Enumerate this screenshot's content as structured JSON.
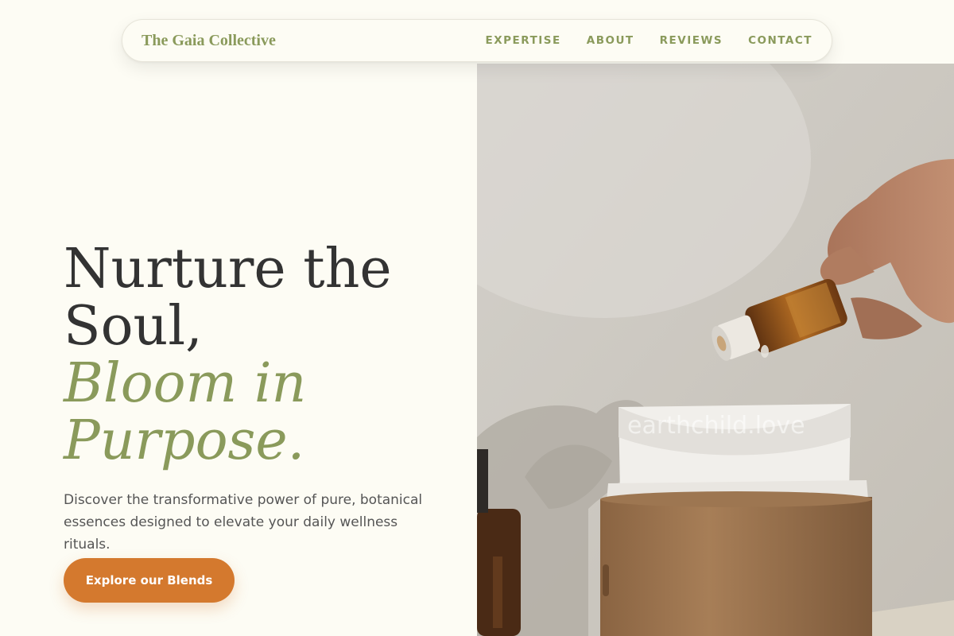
{
  "nav": {
    "brand": "The Gaia Collective",
    "links": [
      "EXPERTISE",
      "ABOUT",
      "REVIEWS",
      "CONTACT"
    ]
  },
  "hero": {
    "title_line1": "Nurture the",
    "title_line2": "Soul,",
    "accent_line1": "Bloom in",
    "accent_line2": "Purpose.",
    "subtitle": "Discover the transformative power of pure, botanical essences designed to elevate your daily wellness rituals.",
    "cta_label": "Explore our Blends",
    "image_watermark": "earthchild.love"
  },
  "colors": {
    "background": "#fdfcf4",
    "accent_green": "#8a9a5b",
    "cta_orange": "#d4792e",
    "text_dark": "#333333"
  }
}
